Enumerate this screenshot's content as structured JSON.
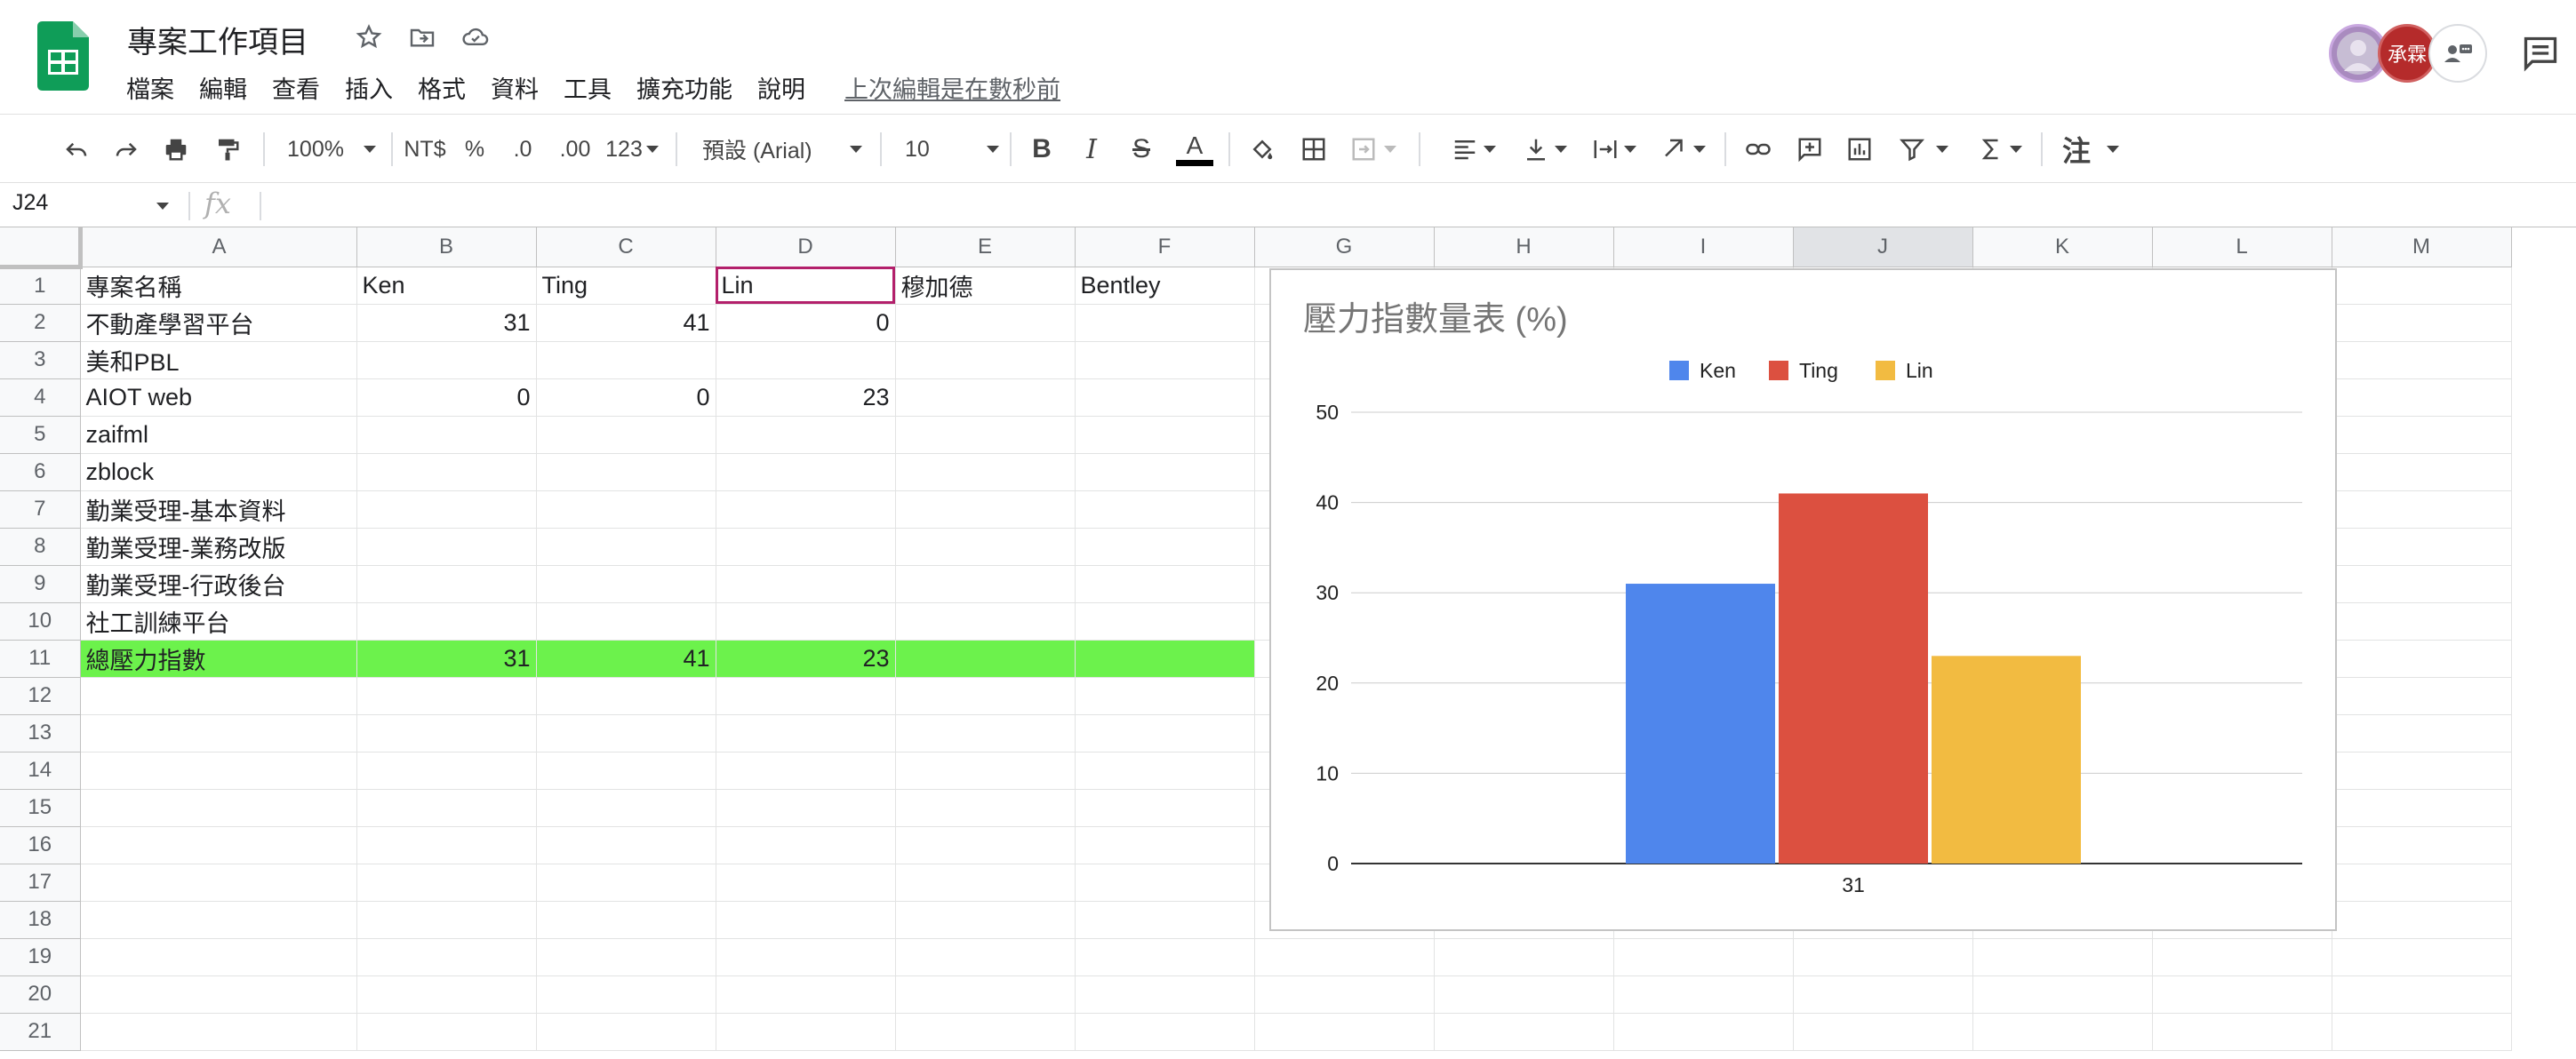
{
  "document": {
    "title": "專案工作項目",
    "last_edit": "上次編輯是在數秒前"
  },
  "menu": [
    "檔案",
    "編輯",
    "查看",
    "插入",
    "格式",
    "資料",
    "工具",
    "擴充功能",
    "說明"
  ],
  "collaborators": [
    {
      "initials": "",
      "color": "#a98bbf"
    },
    {
      "initials": "承霖",
      "color": "#b52b2b"
    },
    {
      "initials": "",
      "color": "#ffffff"
    }
  ],
  "toolbar": {
    "zoom": "100%",
    "currency": "NT$",
    "percent": "%",
    "decrease_decimal": ".0",
    "increase_decimal": ".00",
    "more_formats": "123",
    "font_family": "預設 (Arial)",
    "font_size": "10",
    "bold": "B",
    "italic": "I",
    "strikethrough": "S",
    "text_color": "A",
    "input_tools": "注"
  },
  "formula_bar": {
    "name_box": "J24",
    "fx": "fx",
    "value": ""
  },
  "sheet": {
    "columns": [
      "A",
      "B",
      "C",
      "D",
      "E",
      "F",
      "G",
      "H",
      "I",
      "J",
      "K",
      "L",
      "M"
    ],
    "row_numbers": [
      "1",
      "2",
      "3",
      "4",
      "5",
      "6",
      "7",
      "8",
      "9",
      "10",
      "11",
      "12",
      "13",
      "14",
      "15",
      "16",
      "17",
      "18",
      "19",
      "20",
      "21"
    ],
    "rows": [
      [
        "專案名稱",
        "Ken",
        "Ting",
        "Lin",
        "穆加德",
        "Bentley"
      ],
      [
        "不動產學習平台",
        "31",
        "41",
        "0",
        "",
        ""
      ],
      [
        "美和PBL",
        "",
        "",
        "",
        "",
        ""
      ],
      [
        "AIOT web",
        "0",
        "0",
        "23",
        "",
        ""
      ],
      [
        "zaifml",
        "",
        "",
        "",
        "",
        ""
      ],
      [
        "zblock",
        "",
        "",
        "",
        "",
        ""
      ],
      [
        "勤業受理-基本資料",
        "",
        "",
        "",
        "",
        ""
      ],
      [
        "勤業受理-業務改版",
        "",
        "",
        "",
        "",
        ""
      ],
      [
        "勤業受理-行政後台",
        "",
        "",
        "",
        "",
        ""
      ],
      [
        "社工訓練平台",
        "",
        "",
        "",
        "",
        ""
      ],
      [
        "總壓力指數",
        "31",
        "41",
        "23",
        "",
        ""
      ]
    ],
    "total_row_color": "#6cf24c",
    "selected_cell": "D1"
  },
  "chart_data": {
    "type": "bar",
    "title": "壓力指數量表 (%)",
    "categories": [
      "31"
    ],
    "series": [
      {
        "name": "Ken",
        "values": [
          31
        ],
        "color": "#4f86ec"
      },
      {
        "name": "Ting",
        "values": [
          41
        ],
        "color": "#dc5040"
      },
      {
        "name": "Lin",
        "values": [
          23
        ],
        "color": "#f2bb41"
      }
    ],
    "ylim": [
      0,
      50
    ],
    "yticks": [
      0,
      10,
      20,
      30,
      40,
      50
    ],
    "legend": "top",
    "grid": true
  },
  "colors": {
    "sheets_green": "#0f9d58",
    "selection": "#b3206b"
  }
}
